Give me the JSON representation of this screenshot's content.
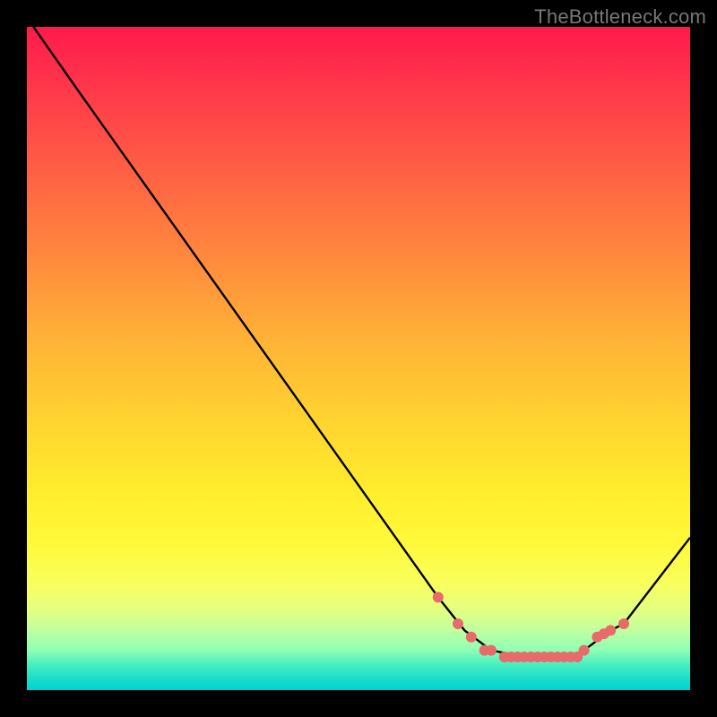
{
  "watermark": "TheBottleneck.com",
  "chart_data": {
    "type": "line",
    "title": "",
    "xlabel": "",
    "ylabel": "",
    "xlim": [
      0,
      100
    ],
    "ylim": [
      0,
      100
    ],
    "background_gradient": [
      "#ff1a4d",
      "#ff8a3d",
      "#ffed2d",
      "#4cf0c0",
      "#00d0d0"
    ],
    "series": [
      {
        "name": "curve",
        "color": "#000000",
        "x": [
          1,
          8,
          62,
          66,
          70,
          75,
          82,
          84,
          88,
          90,
          100
        ],
        "y": [
          100,
          90,
          14,
          9,
          6,
          5,
          5,
          6,
          9,
          10,
          23
        ]
      }
    ],
    "markers": {
      "name": "dots",
      "color": "#e86a6a",
      "radius": 6,
      "x": [
        62,
        65,
        67,
        69,
        70,
        72,
        73,
        74,
        75,
        76,
        77,
        78,
        79,
        80,
        81,
        82,
        83,
        84,
        86,
        87,
        88,
        90
      ],
      "y": [
        14,
        10,
        8,
        6,
        6,
        5,
        5,
        5,
        5,
        5,
        5,
        5,
        5,
        5,
        5,
        5,
        5,
        6,
        8,
        8.5,
        9,
        10
      ]
    }
  }
}
